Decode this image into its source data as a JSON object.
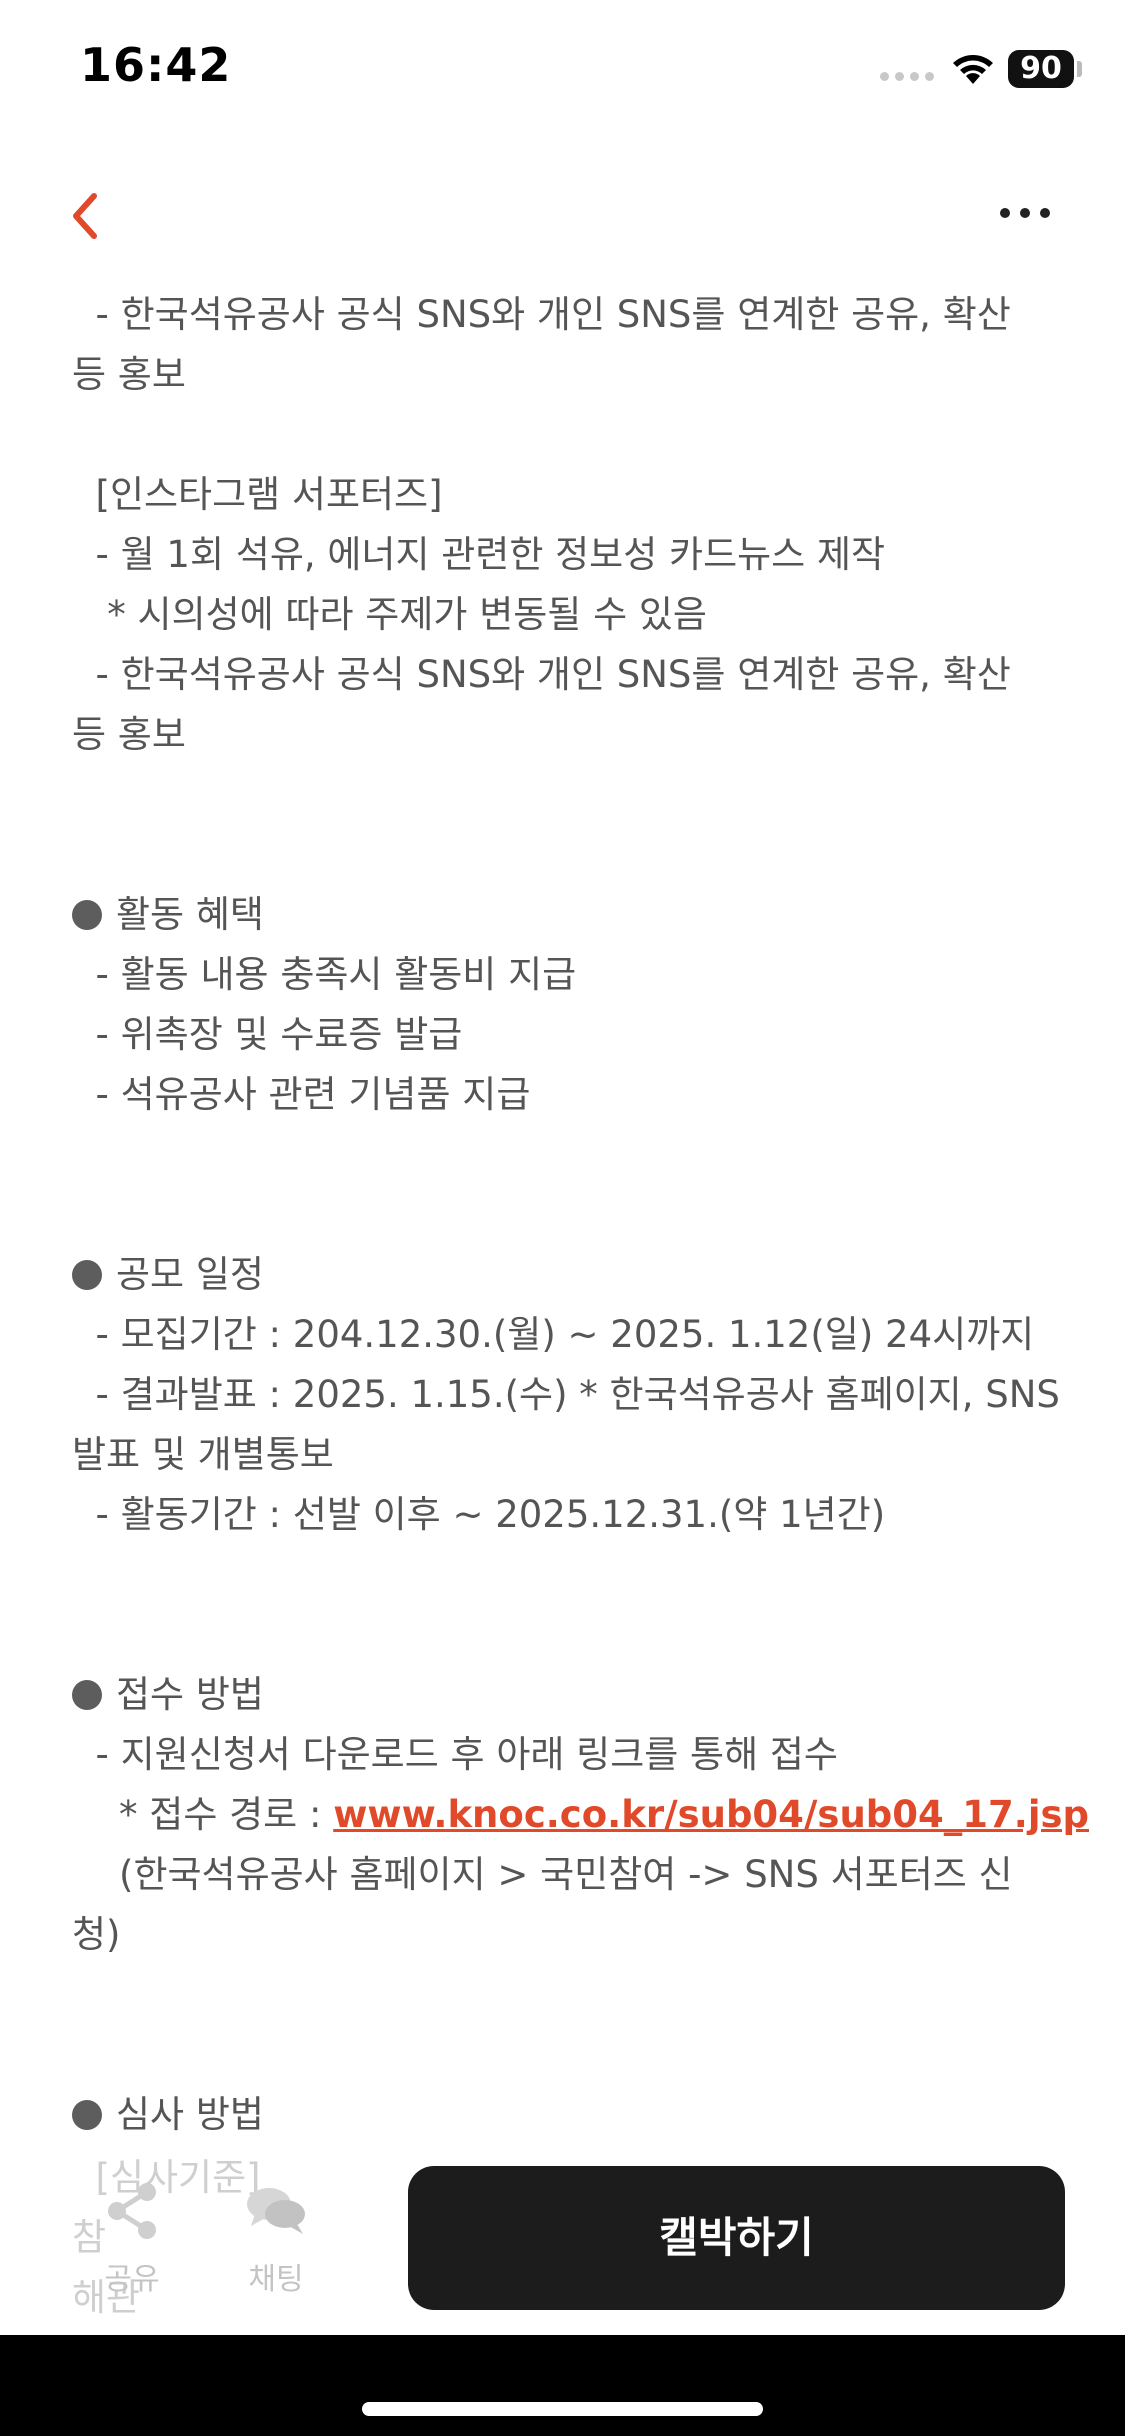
{
  "status_bar": {
    "time": "16:42",
    "battery": "90"
  },
  "nav": {
    "back_icon": "chevron-left-icon",
    "more_icon": "more-dots-icon",
    "accent_color": "#e04a2a"
  },
  "content": {
    "line1": "  - 한국석유공사 공식 SNS와 개인 SNS를 연계한 공유, 확산",
    "line2": "등 홍보",
    "insta_header": "  [인스타그램 서포터즈]",
    "insta_1": "  - 월 1회 석유, 에너지 관련한 정보성 카드뉴스 제작",
    "insta_2": "   * 시의성에 따라 주제가 변동될 수 있음",
    "insta_3": "  - 한국석유공사 공식 SNS와 개인 SNS를 연계한 공유, 확산",
    "insta_4": "등 홍보",
    "benefits_title": "활동 혜택",
    "benefits_1": "  - 활동 내용 충족시 활동비 지급",
    "benefits_2": "  - 위촉장 및 수료증 발급",
    "benefits_3": "  - 석유공사 관련 기념품 지급",
    "schedule_title": "공모 일정",
    "schedule_1": "  - 모집기간 : 204.12.30.(월) ~ 2025. 1.12(일) 24시까지",
    "schedule_2": "  - 결과발표 : 2025. 1.15.(수) * 한국석유공사 홈페이지, SNS",
    "schedule_3": "발표 및 개별통보",
    "schedule_4": "  - 활동기간 : 선발 이후 ~ 2025.12.31.(약 1년간)",
    "apply_title": "접수 방법",
    "apply_1": "  - 지원신청서 다운로드 후 아래 링크를 통해 접수",
    "apply_2_prefix": "    * 접수 경로 : ",
    "apply_link": "www.knoc.co.kr/sub04/sub04_17.jsp",
    "apply_3": "    (한국석유공사 홈페이지 > 국민참여 -> SNS 서포터즈 신",
    "apply_4": "청)",
    "review_title": "심사 방법",
    "review_faded_1": "  [심사기준]",
    "review_faded_2": "참",
    "review_faded_3": "해관"
  },
  "bottom": {
    "share_label": "공유",
    "chat_label": "채팅",
    "cta_label": "캘박하기"
  }
}
